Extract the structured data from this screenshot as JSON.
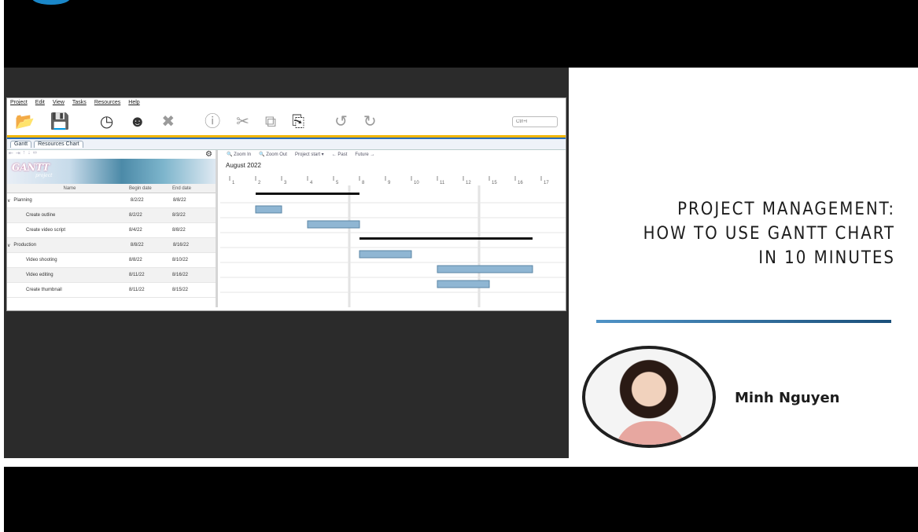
{
  "logo": {
    "text": ""
  },
  "video": {
    "title_lines": [
      "PROJECT MANAGEMENT:",
      "HOW TO USE GANTT CHART",
      "IN 10 MINUTES"
    ],
    "author": "Minh Nguyen"
  },
  "app": {
    "menu": [
      "Project",
      "Edit",
      "View",
      "Tasks",
      "Resources",
      "Help"
    ],
    "toolbar_icons": [
      "folder-open-icon",
      "save-icon",
      "clock-icon",
      "user-icon",
      "close-icon",
      "info-icon",
      "cut-icon",
      "copy-icon",
      "paste-icon",
      "undo-icon",
      "redo-icon"
    ],
    "search_placeholder": "Ctrl+I",
    "tabs": [
      "Gantt",
      "Resources Chart"
    ],
    "banner": {
      "title": "GANTT",
      "subtitle": "project"
    },
    "columns": {
      "name": "Name",
      "begin": "Begin date",
      "end": "End date"
    },
    "tasks": [
      {
        "name": "Planning",
        "begin": "8/2/22",
        "end": "8/8/22",
        "group": true
      },
      {
        "name": "Create outline",
        "begin": "8/2/22",
        "end": "8/3/22",
        "group": false
      },
      {
        "name": "Create video script",
        "begin": "8/4/22",
        "end": "8/8/22",
        "group": false
      },
      {
        "name": "Production",
        "begin": "8/8/22",
        "end": "8/16/22",
        "group": true
      },
      {
        "name": "Video shooting",
        "begin": "8/8/22",
        "end": "8/10/22",
        "group": false
      },
      {
        "name": "Video editing",
        "begin": "8/11/22",
        "end": "8/16/22",
        "group": false
      },
      {
        "name": "Create thumbnail",
        "begin": "8/11/22",
        "end": "8/15/22",
        "group": false
      }
    ],
    "chart_toolbar": {
      "zoom_in": "Zoom In",
      "zoom_out": "Zoom Out",
      "project_start": "Project start",
      "past": "← Past",
      "future": "Future →"
    },
    "month": "August 2022",
    "day_ticks": [
      "1",
      "2",
      "3",
      "4",
      "5",
      "8",
      "9",
      "10",
      "11",
      "12",
      "15",
      "16",
      "17"
    ],
    "colors": {
      "task_bar": "#8fb6d3",
      "summary_bar": "#111111",
      "accent": "#f2b600",
      "divider": "#2a6ebb"
    }
  }
}
